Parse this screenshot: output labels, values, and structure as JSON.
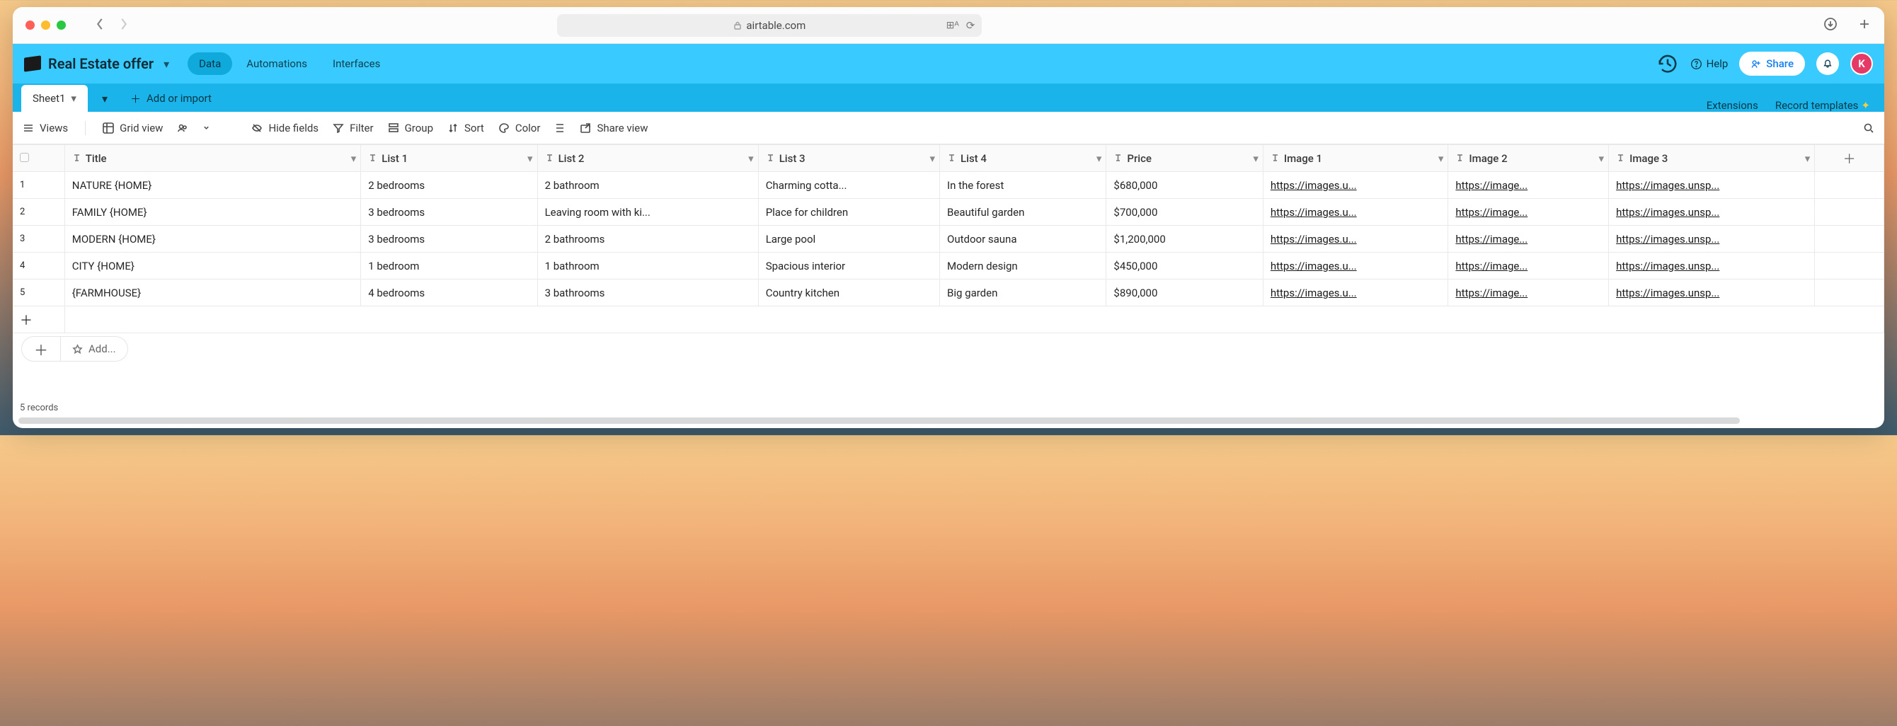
{
  "browser": {
    "domain": "airtable.com"
  },
  "app": {
    "base_name": "Real Estate offer",
    "nav": {
      "data": "Data",
      "automations": "Automations",
      "interfaces": "Interfaces"
    },
    "help": "Help",
    "share": "Share",
    "avatar_letter": "K"
  },
  "tabs": {
    "sheet1": "Sheet1",
    "add_or_import": "Add or import",
    "extensions": "Extensions",
    "record_templates": "Record templates"
  },
  "toolbar": {
    "views": "Views",
    "gridview": "Grid view",
    "hidefields": "Hide fields",
    "filter": "Filter",
    "group": "Group",
    "sort": "Sort",
    "color": "Color",
    "shareview": "Share view"
  },
  "columns": {
    "title": "Title",
    "list1": "List 1",
    "list2": "List 2",
    "list3": "List 3",
    "list4": "List 4",
    "price": "Price",
    "image1": "Image 1",
    "image2": "Image 2",
    "image3": "Image 3"
  },
  "rows": [
    {
      "n": "1",
      "title": "NATURE {HOME}",
      "l1": "2 bedrooms",
      "l2": "2 bathroom",
      "l3": "Charming cotta...",
      "l4": "In the forest",
      "price": "$680,000",
      "i1": "https://images.u...",
      "i2": "https://image...",
      "i3": "https://images.unsp..."
    },
    {
      "n": "2",
      "title": "FAMILY {HOME}",
      "l1": "3 bedrooms",
      "l2": "Leaving room with ki...",
      "l3": "Place for children",
      "l4": "Beautiful garden",
      "price": "$700,000",
      "i1": "https://images.u...",
      "i2": "https://image...",
      "i3": "https://images.unsp..."
    },
    {
      "n": "3",
      "title": "MODERN {HOME}",
      "l1": "3 bedrooms",
      "l2": "2 bathrooms",
      "l3": "Large pool",
      "l4": "Outdoor sauna",
      "price": "$1,200,000",
      "i1": "https://images.u...",
      "i2": "https://image...",
      "i3": "https://images.unsp..."
    },
    {
      "n": "4",
      "title": "CITY {HOME}",
      "l1": "1 bedroom",
      "l2": "1 bathroom",
      "l3": "Spacious interior",
      "l4": "Modern design",
      "price": "$450,000",
      "i1": "https://images.u...",
      "i2": "https://image...",
      "i3": "https://images.unsp..."
    },
    {
      "n": "5",
      "title": "{FARMHOUSE}",
      "l1": "4 bedrooms",
      "l2": "3 bathrooms",
      "l3": "Country kitchen",
      "l4": "Big garden",
      "price": "$890,000",
      "i1": "https://images.u...",
      "i2": "https://image...",
      "i3": "https://images.unsp..."
    }
  ],
  "footer": {
    "addlabel": "Add...",
    "records_count": "5 records"
  }
}
